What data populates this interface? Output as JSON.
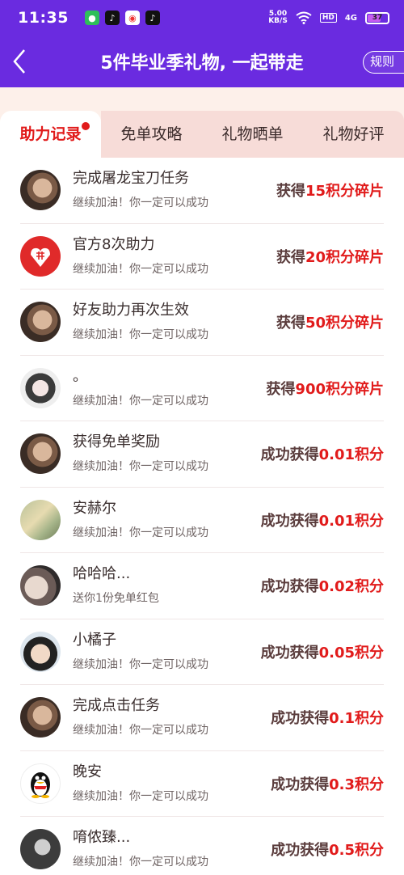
{
  "status": {
    "time": "11:35",
    "speed_top": "5.00",
    "speed_unit": "KB/S",
    "hd": "HD",
    "signal": "4G",
    "battery": "37"
  },
  "header": {
    "title": "5件毕业季礼物, 一起带走",
    "rules_label": "规则"
  },
  "tabs": [
    {
      "label": "助力记录",
      "active": true
    },
    {
      "label": "免单攻略"
    },
    {
      "label": "礼物晒单"
    },
    {
      "label": "礼物好评"
    }
  ],
  "records": [
    {
      "name": "完成屠龙宝刀任务",
      "sub": "继续加油！你一定可以成功",
      "prefix": "获得",
      "amount": "15积分碎片",
      "avatar": "face"
    },
    {
      "name": "官方8次助力",
      "sub": "继续加油！你一定可以成功",
      "prefix": "获得",
      "amount": "20积分碎片",
      "avatar": "pdd"
    },
    {
      "name": "好友助力再次生效",
      "sub": "继续加油！你一定可以成功",
      "prefix": "获得",
      "amount": "50积分碎片",
      "avatar": "face"
    },
    {
      "name": "。",
      "sub": "继续加油！你一定可以成功",
      "prefix": "获得",
      "amount": "900积分碎片",
      "avatar": "girl"
    },
    {
      "name": "获得免单奖励",
      "sub": "继续加油！你一定可以成功",
      "prefix": "成功获得",
      "amount": "0.01积分",
      "avatar": "face"
    },
    {
      "name": "安赫尔",
      "sub": "继续加油！你一定可以成功",
      "prefix": "成功获得",
      "amount": "0.01积分",
      "avatar": "art"
    },
    {
      "name": "哈哈哈...",
      "sub": "送你1份免单红包",
      "prefix": "成功获得",
      "amount": "0.02积分",
      "avatar": "cat"
    },
    {
      "name": "小橘子",
      "sub": "继续加油！你一定可以成功",
      "prefix": "成功获得",
      "amount": "0.05积分",
      "avatar": "boy"
    },
    {
      "name": "完成点击任务",
      "sub": "继续加油！你一定可以成功",
      "prefix": "成功获得",
      "amount": "0.1积分",
      "avatar": "face"
    },
    {
      "name": "晚安",
      "sub": "继续加油！你一定可以成功",
      "prefix": "成功获得",
      "amount": "0.3积分",
      "avatar": "qq"
    },
    {
      "name": "唷侬臻...",
      "sub": "继续加油！你一定可以成功",
      "prefix": "成功获得",
      "amount": "0.5积分",
      "avatar": "dark"
    }
  ],
  "colors": {
    "header": "#6a2be0",
    "accent": "#e11b1b",
    "tab_bg": "#f7dcd8"
  }
}
